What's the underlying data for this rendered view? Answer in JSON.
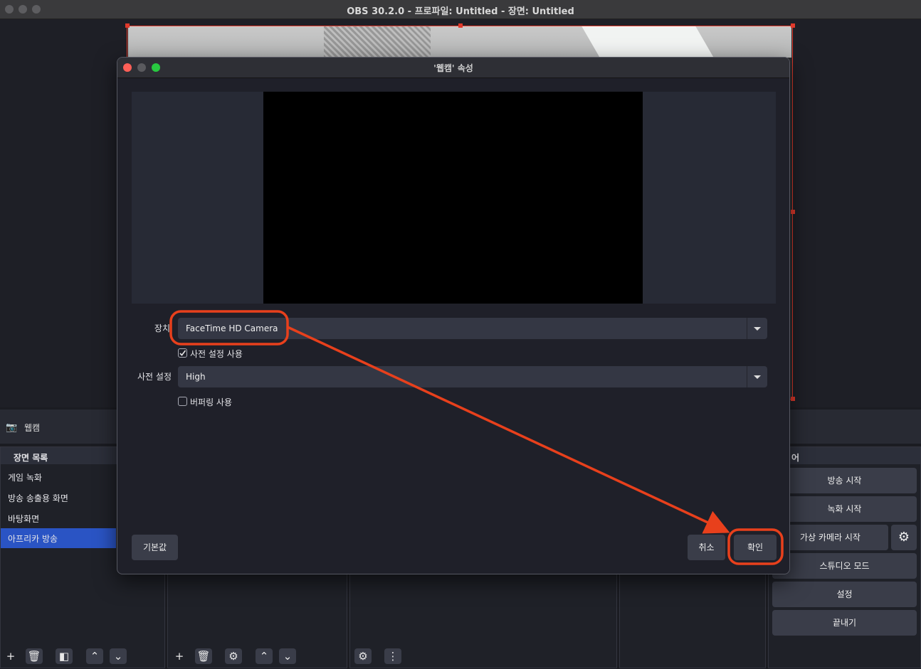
{
  "main_window": {
    "title": "OBS 30.2.0 - 프로파일: Untitled - 장면: Untitled"
  },
  "sources_bar": {
    "source_label": "웹캠"
  },
  "scenes_dock": {
    "title": "장면 목록",
    "items": [
      {
        "label": "게임 녹화",
        "selected": false
      },
      {
        "label": "방송 송출용 화면",
        "selected": false
      },
      {
        "label": "바탕화면",
        "selected": false
      },
      {
        "label": "아프리카 방송",
        "selected": true
      }
    ]
  },
  "controls_dock": {
    "title_fragment": "어",
    "buttons": {
      "start_streaming": "방송 시작",
      "start_recording": "녹화 시작",
      "start_virtual_cam": "가상 카메라 시작",
      "studio_mode": "스튜디오 모드",
      "settings": "설정",
      "exit": "끝내기"
    }
  },
  "dialog": {
    "title": "'웹캠' 속성",
    "device": {
      "label": "장치",
      "value": "FaceTime HD Camera"
    },
    "use_preset": {
      "label": "사전 설정 사용",
      "checked": true
    },
    "preset": {
      "label": "사전 설정",
      "value": "High"
    },
    "buffering": {
      "label": "버퍼링 사용",
      "checked": false
    },
    "buttons": {
      "defaults": "기본값",
      "cancel": "취소",
      "ok": "확인"
    }
  },
  "icons": {
    "camera": "camera-icon",
    "add": "plus-icon",
    "remove": "trash-icon",
    "filter": "filter-icon",
    "up": "chevron-up-icon",
    "down": "chevron-down-icon",
    "gear": "gear-icon",
    "more": "more-icon"
  },
  "colors": {
    "annotation": "#e8401c",
    "selection": "#2a54c4",
    "handle": "#e0392b"
  }
}
